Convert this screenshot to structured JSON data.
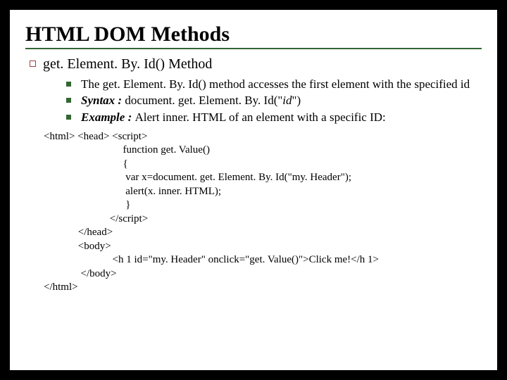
{
  "title": "HTML DOM Methods",
  "subhead": "get. Element. By. Id() Method",
  "points": {
    "p1": "The get. Element. By. Id() method accesses the first element with the specified id",
    "p2_label": "Syntax : ",
    "p2_body": "document. get. Element. By. Id(\"",
    "p2_arg": "id",
    "p2_tail": "\")",
    "p3_label": "Example : ",
    "p3_body": "Alert inner. HTML of an element with a specific ID:"
  },
  "code": {
    "l1": "<html> <head> <script>",
    "l2": "                              function get. Value()",
    "l3": "                              {",
    "l4": "                               var x=document. get. Element. By. Id(\"my. Header\");",
    "l5": "                               alert(x. inner. HTML);",
    "l6": "                               }",
    "l7": "                         </script>",
    "l8": "             </head>",
    "l9": "             <body>",
    "l10": "                          <h 1 id=\"my. Header\" onclick=\"get. Value()\">Click me!</h 1>",
    "l11": "              </body>",
    "l12": "</html>"
  }
}
